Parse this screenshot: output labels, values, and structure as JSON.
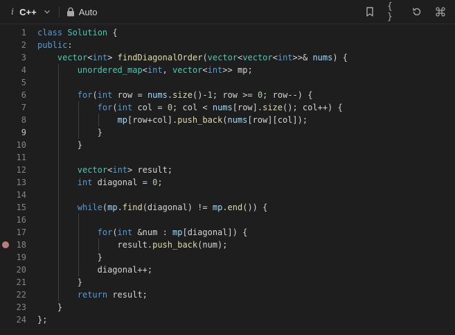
{
  "toolbar": {
    "info_glyph": "i",
    "language": "C++",
    "mode": "Auto",
    "icons": [
      "info-icon",
      "chevron-down-icon",
      "lock-icon",
      "bookmark-icon",
      "braces-icon",
      "reset-icon",
      "command-icon"
    ],
    "braces_glyph": "{ }"
  },
  "editor": {
    "current_line": 9,
    "breakpoint_line": 18,
    "lines": [
      {
        "n": "1",
        "indent": 0,
        "t": [
          [
            "kw",
            "class "
          ],
          [
            "ty",
            "Solution"
          ],
          [
            "op",
            " {"
          ]
        ]
      },
      {
        "n": "2",
        "indent": 0,
        "t": [
          [
            "kw",
            "public"
          ],
          [
            "op",
            ":"
          ]
        ]
      },
      {
        "n": "3",
        "indent": 1,
        "t": [
          [
            "ty",
            "vector"
          ],
          [
            "op",
            "<"
          ],
          [
            "kw",
            "int"
          ],
          [
            "op",
            "> "
          ],
          [
            "fn",
            "findDiagonalOrder"
          ],
          [
            "op",
            "("
          ],
          [
            "ty",
            "vector"
          ],
          [
            "op",
            "<"
          ],
          [
            "ty",
            "vector"
          ],
          [
            "op",
            "<"
          ],
          [
            "kw",
            "int"
          ],
          [
            "op",
            ">>& "
          ],
          [
            "va",
            "nums"
          ],
          [
            "op",
            ") {"
          ]
        ]
      },
      {
        "n": "4",
        "indent": 2,
        "t": [
          [
            "ty",
            "unordered_map"
          ],
          [
            "op",
            "<"
          ],
          [
            "kw",
            "int"
          ],
          [
            "op",
            ", "
          ],
          [
            "ty",
            "vector"
          ],
          [
            "op",
            "<"
          ],
          [
            "kw",
            "int"
          ],
          [
            "op",
            ">> mp;"
          ]
        ]
      },
      {
        "n": "5",
        "indent": 2,
        "t": []
      },
      {
        "n": "6",
        "indent": 2,
        "t": [
          [
            "kw",
            "for"
          ],
          [
            "op",
            "("
          ],
          [
            "kw",
            "int"
          ],
          [
            "op",
            " row = "
          ],
          [
            "va",
            "nums"
          ],
          [
            "op",
            "."
          ],
          [
            "fn",
            "size"
          ],
          [
            "op",
            "()-"
          ],
          [
            "nu",
            "1"
          ],
          [
            "op",
            "; row >= "
          ],
          [
            "nu",
            "0"
          ],
          [
            "op",
            "; row--) {"
          ]
        ]
      },
      {
        "n": "7",
        "indent": 3,
        "t": [
          [
            "kw",
            "for"
          ],
          [
            "op",
            "("
          ],
          [
            "kw",
            "int"
          ],
          [
            "op",
            " col = "
          ],
          [
            "nu",
            "0"
          ],
          [
            "op",
            "; col < "
          ],
          [
            "va",
            "nums"
          ],
          [
            "op",
            "[row]."
          ],
          [
            "fn",
            "size"
          ],
          [
            "op",
            "(); col++) {"
          ]
        ]
      },
      {
        "n": "8",
        "indent": 4,
        "t": [
          [
            "va",
            "mp"
          ],
          [
            "op",
            "[row+col]."
          ],
          [
            "fn",
            "push_back"
          ],
          [
            "op",
            "("
          ],
          [
            "va",
            "nums"
          ],
          [
            "op",
            "[row][col]);"
          ]
        ]
      },
      {
        "n": "9",
        "indent": 3,
        "t": [
          [
            "op",
            "}"
          ]
        ]
      },
      {
        "n": "10",
        "indent": 2,
        "t": [
          [
            "op",
            "}"
          ]
        ]
      },
      {
        "n": "11",
        "indent": 2,
        "t": []
      },
      {
        "n": "12",
        "indent": 2,
        "t": [
          [
            "ty",
            "vector"
          ],
          [
            "op",
            "<"
          ],
          [
            "kw",
            "int"
          ],
          [
            "op",
            "> result;"
          ]
        ]
      },
      {
        "n": "13",
        "indent": 2,
        "t": [
          [
            "kw",
            "int"
          ],
          [
            "op",
            " diagonal = "
          ],
          [
            "nu",
            "0"
          ],
          [
            "op",
            ";"
          ]
        ]
      },
      {
        "n": "14",
        "indent": 2,
        "t": []
      },
      {
        "n": "15",
        "indent": 2,
        "t": [
          [
            "kw",
            "while"
          ],
          [
            "op",
            "("
          ],
          [
            "va",
            "mp"
          ],
          [
            "op",
            "."
          ],
          [
            "fn",
            "find"
          ],
          [
            "op",
            "(diagonal) != "
          ],
          [
            "va",
            "mp"
          ],
          [
            "op",
            "."
          ],
          [
            "fn",
            "end"
          ],
          [
            "op",
            "()) {"
          ]
        ]
      },
      {
        "n": "16",
        "indent": 3,
        "t": []
      },
      {
        "n": "17",
        "indent": 3,
        "t": [
          [
            "kw",
            "for"
          ],
          [
            "op",
            "("
          ],
          [
            "kw",
            "int"
          ],
          [
            "op",
            " &num : "
          ],
          [
            "va",
            "mp"
          ],
          [
            "op",
            "[diagonal]) {"
          ]
        ]
      },
      {
        "n": "18",
        "indent": 4,
        "t": [
          [
            "op",
            "result."
          ],
          [
            "fn",
            "push_back"
          ],
          [
            "op",
            "(num);"
          ]
        ]
      },
      {
        "n": "19",
        "indent": 3,
        "t": [
          [
            "op",
            "}"
          ]
        ]
      },
      {
        "n": "20",
        "indent": 3,
        "t": [
          [
            "op",
            "diagonal++;"
          ]
        ]
      },
      {
        "n": "21",
        "indent": 2,
        "t": [
          [
            "op",
            "}"
          ]
        ]
      },
      {
        "n": "22",
        "indent": 2,
        "t": [
          [
            "kw",
            "return"
          ],
          [
            "op",
            " result;"
          ]
        ]
      },
      {
        "n": "23",
        "indent": 1,
        "t": [
          [
            "op",
            "}"
          ]
        ]
      },
      {
        "n": "24",
        "indent": 0,
        "t": [
          [
            "op",
            "};"
          ]
        ]
      }
    ]
  }
}
